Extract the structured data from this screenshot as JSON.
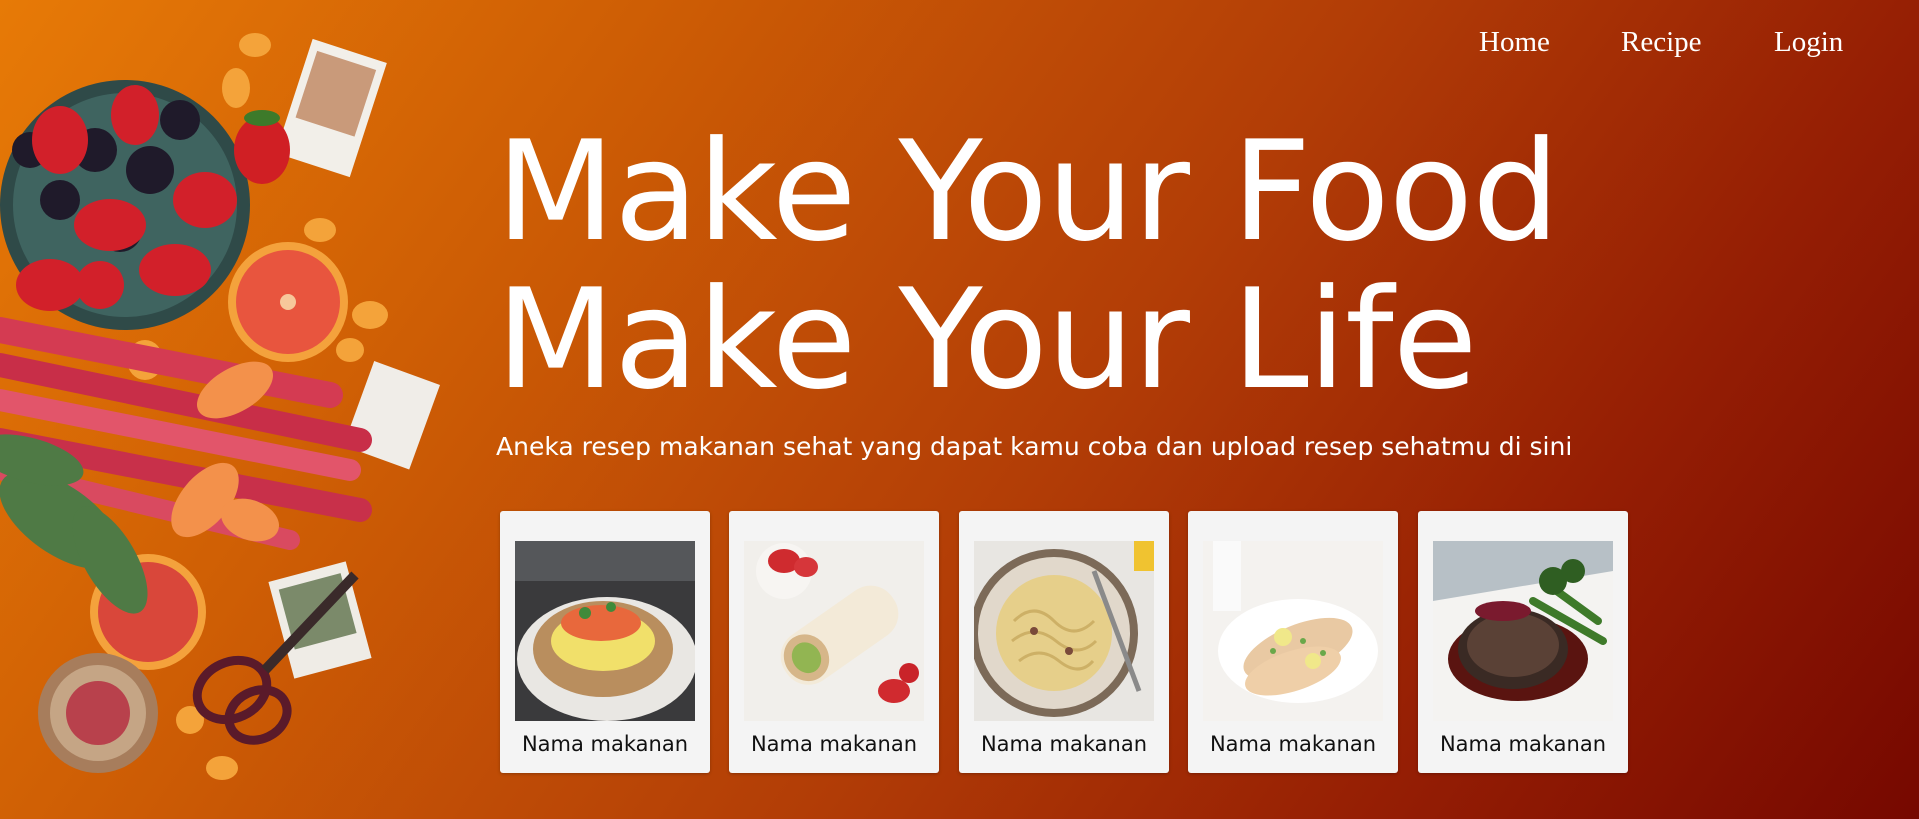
{
  "nav": {
    "items": [
      {
        "label": "Home"
      },
      {
        "label": "Recipe"
      },
      {
        "label": "Login"
      }
    ]
  },
  "hero": {
    "title_line1": "Make Your Food",
    "title_line2": "Make Your Life",
    "subtitle": "Aneka resep makanan sehat yang dapat kamu coba dan upload resep sehatmu di sini"
  },
  "cards": [
    {
      "label": "Nama makanan",
      "image": "salmon-toast-photo"
    },
    {
      "label": "Nama makanan",
      "image": "wrap-sandwich-photo"
    },
    {
      "label": "Nama makanan",
      "image": "pasta-bowl-photo"
    },
    {
      "label": "Nama makanan",
      "image": "fish-fillet-photo"
    },
    {
      "label": "Nama makanan",
      "image": "steak-plate-photo"
    }
  ],
  "colors": {
    "background_start": "#e77a06",
    "background_end": "#760800",
    "text": "#ffffff",
    "card_background": "#f4f4f4"
  }
}
